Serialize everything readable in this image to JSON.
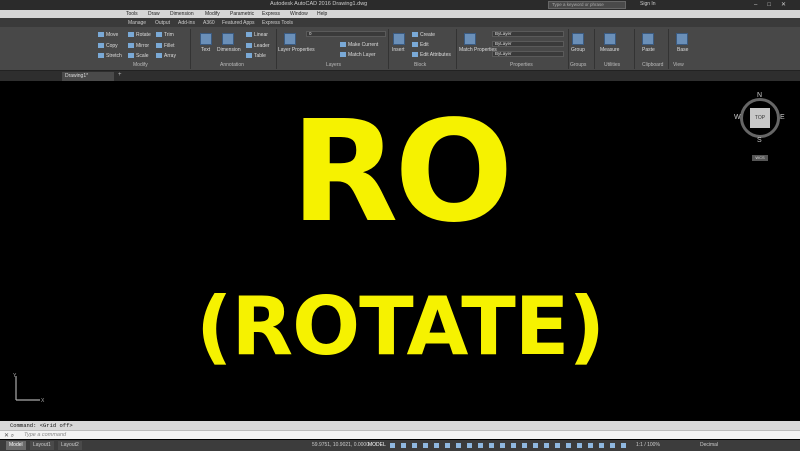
{
  "window": {
    "title": "Autodesk AutoCAD 2016   Drawing1.dwg",
    "search_placeholder": "Type a keyword or phrase",
    "signin": "Sign In",
    "controls": "–□✕"
  },
  "menu": [
    "Tools",
    "Draw",
    "Dimension",
    "Modify",
    "Parametric",
    "Express",
    "Window",
    "Help"
  ],
  "ribbon_tabs": [
    "Manage",
    "Output",
    "Add-ins",
    "A360",
    "Featured Apps",
    "Express Tools"
  ],
  "ribbon": {
    "modify": {
      "title": "Modify",
      "tools": [
        "Move",
        "Rotate",
        "Trim",
        "Copy",
        "Mirror",
        "Fillet",
        "Stretch",
        "Scale",
        "Array"
      ]
    },
    "annotation": {
      "title": "Annotation",
      "tools": [
        "Text",
        "Dimension",
        "Linear",
        "Leader",
        "Table"
      ]
    },
    "layers": {
      "title": "Layers",
      "tools": [
        "Layer Properties",
        "Make Current",
        "Match Layer"
      ],
      "current_layer": "0"
    },
    "block": {
      "title": "Block",
      "tools": [
        "Insert",
        "Create",
        "Edit",
        "Edit Attributes"
      ]
    },
    "properties": {
      "title": "Properties",
      "tools": [
        "Match Properties"
      ],
      "color": "ByLayer",
      "linetype": "ByLayer",
      "lineweight": "ByLayer"
    },
    "groups": {
      "title": "Groups",
      "tools": [
        "Group"
      ]
    },
    "utilities": {
      "title": "Utilities",
      "tools": [
        "Measure"
      ]
    },
    "clipboard": {
      "title": "Clipboard",
      "tools": [
        "Paste"
      ]
    },
    "view": {
      "title": "View",
      "tools": [
        "Base"
      ]
    }
  },
  "document_tab": "Drawing1*",
  "overlay": {
    "line1": "RO",
    "line2": "(ROTATE)",
    "color": "#f6f200"
  },
  "viewcube": {
    "top_face": "TOP",
    "north": "N",
    "south": "S",
    "east": "E",
    "west": "W",
    "wcs": "WCS"
  },
  "command": {
    "history": "Command:  <Grid off>",
    "placeholder": "Type a command"
  },
  "status": {
    "layout_tabs": [
      "Model",
      "Layout1",
      "Layout2"
    ],
    "coords": "59.9751, 10.9021, 0.0000",
    "mode": "MODEL",
    "scale": "1:1 / 100%",
    "units": "Decimal"
  },
  "logo": {
    "name": "house-logo-icon"
  }
}
